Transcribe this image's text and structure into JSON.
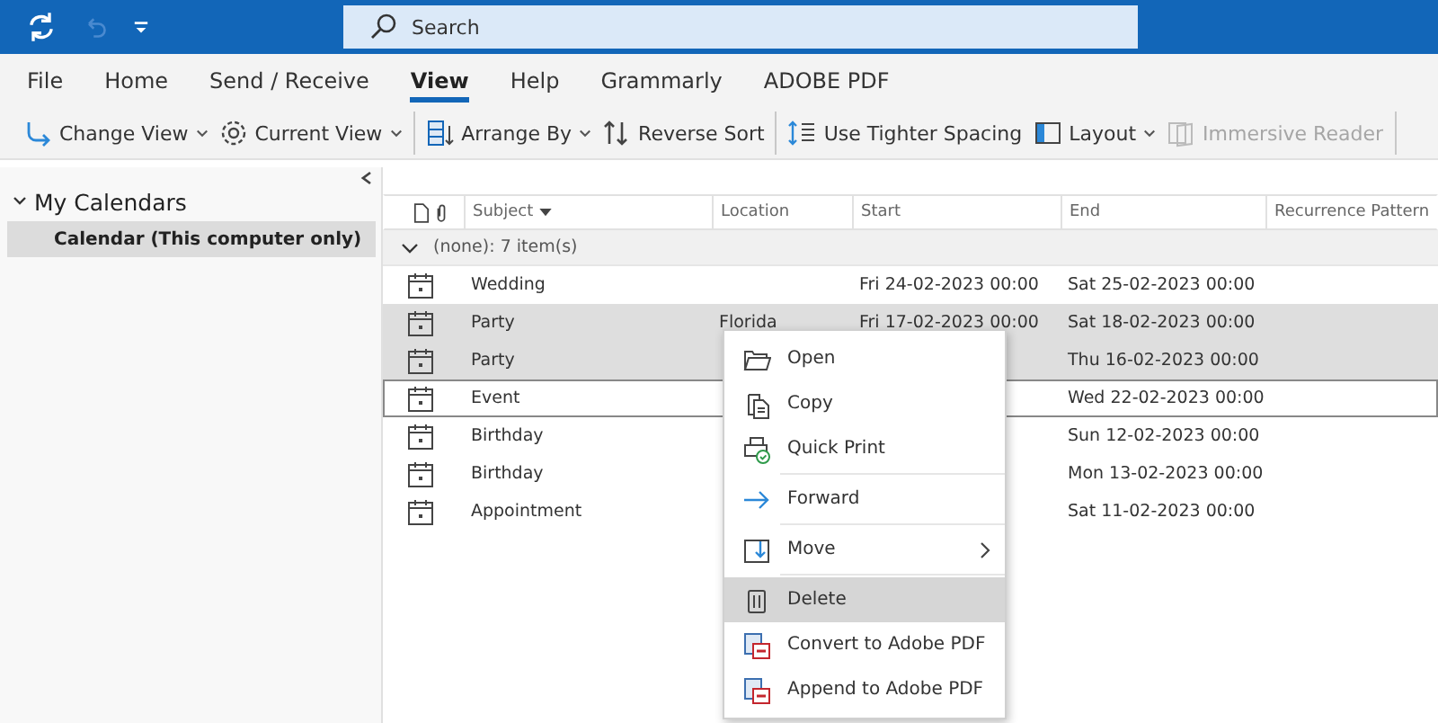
{
  "title_bar": {
    "search": {
      "placeholder": "Search"
    }
  },
  "ribbon_tabs": [
    {
      "label": "File",
      "selected": false
    },
    {
      "label": "Home",
      "selected": false
    },
    {
      "label": "Send / Receive",
      "selected": false
    },
    {
      "label": "View",
      "selected": true
    },
    {
      "label": "Help",
      "selected": false
    },
    {
      "label": "Grammarly",
      "selected": false
    },
    {
      "label": "ADOBE PDF",
      "selected": false
    }
  ],
  "toolbar": [
    {
      "kind": "change",
      "label": "Change View",
      "dropdown": true,
      "disabled": false
    },
    {
      "kind": "gear",
      "label": "Current View",
      "dropdown": true,
      "disabled": false
    },
    {
      "kind": "arrange",
      "label": "Arrange By",
      "dropdown": true,
      "disabled": false
    },
    {
      "kind": "sort",
      "label": "Reverse Sort",
      "dropdown": false,
      "disabled": false
    },
    {
      "kind": "spacing",
      "label": "Use Tighter Spacing",
      "dropdown": false,
      "disabled": false
    },
    {
      "kind": "layout",
      "label": "Layout",
      "dropdown": true,
      "disabled": false
    },
    {
      "kind": "reader",
      "label": "Immersive Reader",
      "dropdown": false,
      "disabled": true
    }
  ],
  "sidebar": {
    "title": "My Calendars",
    "expanded": true,
    "items": [
      {
        "label": "Calendar (This computer only)",
        "selected": true
      }
    ]
  },
  "table": {
    "columns": [
      "Subject",
      "Location",
      "Start",
      "End",
      "Recurrence Pattern"
    ],
    "group": {
      "label": "(none): 7 item(s)",
      "expanded": true
    },
    "rows": [
      {
        "subject": "Wedding",
        "location": "",
        "start": "Fri 24-02-2023 00:00",
        "end": "Sat 25-02-2023 00:00",
        "selected": false,
        "focused": false
      },
      {
        "subject": "Party",
        "location": "Florida",
        "start": "Fri 17-02-2023 00:00",
        "end": "Sat 18-02-2023 00:00",
        "selected": true,
        "focused": false
      },
      {
        "subject": "Party",
        "location": "",
        "start": "",
        "end": "Thu 16-02-2023 00:00",
        "selected": true,
        "focused": false
      },
      {
        "subject": "Event",
        "location": "",
        "start": "",
        "end": "Wed 22-02-2023 00:00",
        "selected": false,
        "focused": true
      },
      {
        "subject": "Birthday",
        "location": "",
        "start": "",
        "end": "Sun 12-02-2023 00:00",
        "selected": false,
        "focused": false
      },
      {
        "subject": "Birthday",
        "location": "",
        "start": "",
        "end": "Mon 13-02-2023 00:00",
        "selected": false,
        "focused": false
      },
      {
        "subject": "Appointment",
        "location": "",
        "start": "",
        "end": "Sat 11-02-2023 00:00",
        "selected": false,
        "focused": false
      }
    ]
  },
  "context_menu": [
    {
      "kind": "open",
      "label": "Open",
      "selected": false,
      "submenu": false
    },
    {
      "kind": "copy",
      "label": "Copy",
      "selected": false,
      "submenu": false
    },
    {
      "kind": "print",
      "label": "Quick Print",
      "selected": false,
      "submenu": false
    },
    {
      "kind": "forward",
      "label": "Forward",
      "selected": false,
      "submenu": false
    },
    {
      "kind": "move",
      "label": "Move",
      "selected": false,
      "submenu": true
    },
    {
      "kind": "delete",
      "label": "Delete",
      "selected": true,
      "submenu": false
    },
    {
      "kind": "pdf",
      "label": "Convert to Adobe PDF",
      "selected": false,
      "submenu": false
    },
    {
      "kind": "pdf",
      "label": "Append to Adobe PDF",
      "selected": false,
      "submenu": false
    }
  ]
}
